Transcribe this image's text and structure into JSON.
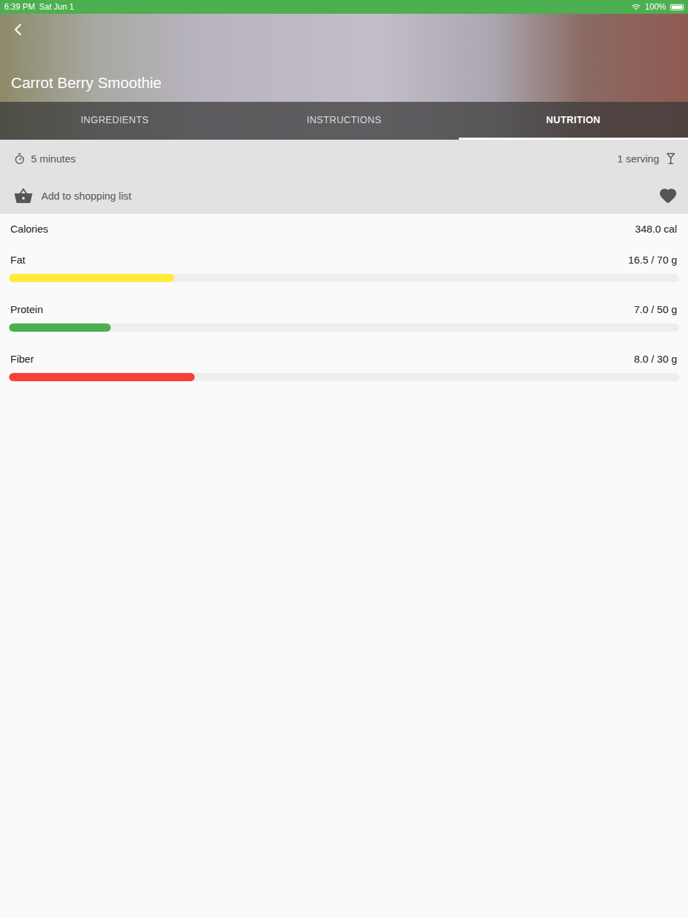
{
  "status_bar": {
    "time": "6:39 PM",
    "date": "Sat Jun 1",
    "battery": "100%"
  },
  "recipe": {
    "title": "Carrot Berry Smoothie"
  },
  "tabs": [
    {
      "label": "INGREDIENTS",
      "selected": false
    },
    {
      "label": "INSTRUCTIONS",
      "selected": false
    },
    {
      "label": "NUTRITION",
      "selected": true
    }
  ],
  "meta": {
    "duration": "5 minutes",
    "servings": "1 serving",
    "shopping_list": "Add to shopping list"
  },
  "calories": {
    "label": "Calories",
    "value": "348.0 cal"
  },
  "nutrients": [
    {
      "name": "Fat",
      "reading": "16.5 / 70 g",
      "level": 0.246,
      "color": "#ffeb3b"
    },
    {
      "name": "Protein",
      "reading": "7.0 / 50 g",
      "level": 0.152,
      "color": "#4caf50"
    },
    {
      "name": "Fiber",
      "reading": "8.0 / 30 g",
      "level": 0.277,
      "color": "#f44336"
    }
  ]
}
